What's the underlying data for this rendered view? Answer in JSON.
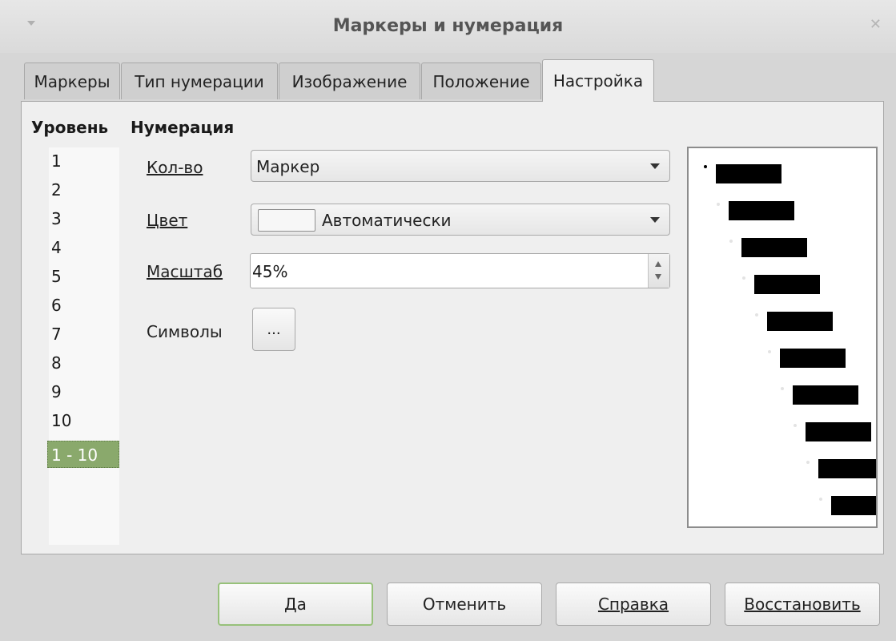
{
  "window": {
    "title": "Маркеры и нумерация"
  },
  "tabs": [
    {
      "label": "Маркеры",
      "active": false
    },
    {
      "label": "Тип нумерации",
      "active": false
    },
    {
      "label": "Изображение",
      "active": false
    },
    {
      "label": "Положение",
      "active": false
    },
    {
      "label": "Настройка",
      "active": true
    }
  ],
  "levels": {
    "header": "Уровень",
    "items": [
      "1",
      "2",
      "3",
      "4",
      "5",
      "6",
      "7",
      "8",
      "9",
      "10",
      "1 - 10"
    ],
    "selected": "1 - 10"
  },
  "numbering": {
    "header": "Нумерация",
    "count": {
      "label": "Кол-во",
      "value": "Маркер"
    },
    "color": {
      "label": "Цвет",
      "value": "Автоматически"
    },
    "scale": {
      "label": "Масштаб",
      "value": "45%"
    },
    "symbols": {
      "label": "Символы",
      "button": "..."
    }
  },
  "buttons": {
    "ok": "Да",
    "cancel": "Отменить",
    "help": "Справка",
    "reset": "Восстановить"
  },
  "colors": {
    "selection": "#8aa96c",
    "default_button_border": "#97c17a"
  },
  "icons": [
    "window-menu-icon",
    "close-icon",
    "dropdown-arrow-icon",
    "spin-up-icon",
    "spin-down-icon"
  ]
}
